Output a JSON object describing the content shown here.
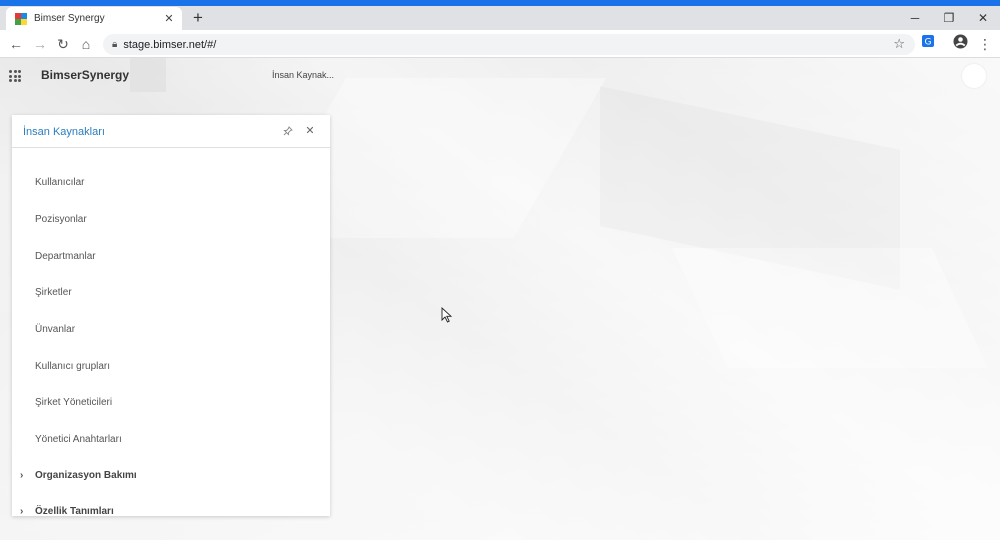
{
  "browser": {
    "tab_title": "Bimser Synergy",
    "url": "stage.bimser.net/#/",
    "accent": "#1a73e8"
  },
  "app": {
    "brand": "BimserSynergy",
    "breadcrumb": "İnsan Kaynak..."
  },
  "panel": {
    "title": "İnsan Kaynakları",
    "title_color": "#2a7dbf",
    "items": [
      "Kullanıcılar",
      "Pozisyonlar",
      "Departmanlar",
      "Şirketler",
      "Ünvanlar",
      "Kullanıcı grupları",
      "Şirket Yöneticileri",
      "Yönetici Anahtarları"
    ],
    "groups": [
      "Organizasyon Bakımı",
      "Özellik Tanımları"
    ]
  }
}
